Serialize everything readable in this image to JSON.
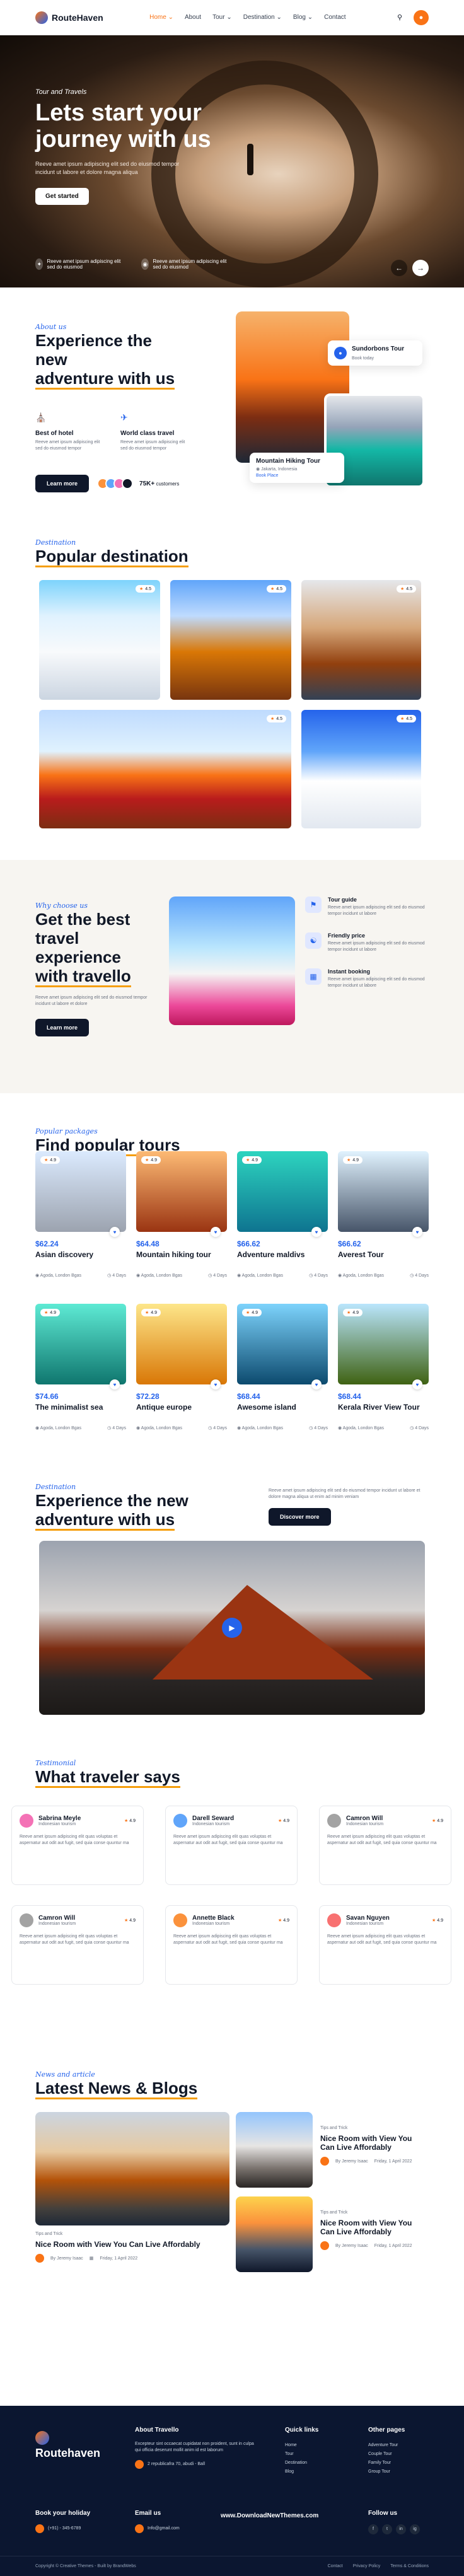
{
  "header": {
    "logo": "RouteHaven",
    "nav": [
      "Home",
      "About",
      "Tour",
      "Destination",
      "Blog",
      "Contact"
    ],
    "chevron": "⌄"
  },
  "hero": {
    "kicker": "Tour and Travels",
    "title": "Lets start your journey with us",
    "subtitle": "Reeve amet ipsum adipiscing elit sed do eiusmod tempor incidunt ut labore et dolore magna aliqua",
    "button": "Get started",
    "features": [
      "Reeve amet ipsum adipiscing elit sed do eiusmod",
      "Reeve amet ipsum adipiscing elit sed do eiusmod"
    ],
    "accent": "#f97316"
  },
  "about": {
    "kicker": "About us",
    "title_line1": "Experience the new",
    "title_line2": "adventure with us",
    "features": [
      {
        "title": "Best of hotel",
        "desc": "Reeve amet ipsum adipiscing elit sed do eiusmod tempor"
      },
      {
        "title": "World class travel",
        "desc": "Reeve amet ipsum adipiscing elit sed do eiusmod tempor"
      }
    ],
    "button": "Learn more",
    "customers_count": "75K+",
    "customers_label": "customers",
    "card1_title": "Sundorbons Tour",
    "card1_sub": "Book today",
    "card2_title": "Mountain Hiking Tour",
    "card2_loc": "Jakarta, Indonesia",
    "card2_link": "Book Place"
  },
  "destinations": {
    "kicker": "Destination",
    "title": "Popular destination",
    "ratings": [
      "4.5",
      "4.5",
      "4.5",
      "4.5",
      "4.5"
    ]
  },
  "why": {
    "kicker": "Why choose us",
    "title_line1": "Get the best",
    "title_line2": "travel experience",
    "title_line3": "with travello",
    "desc": "Reeve amet ipsum adipiscing elit sed do eiusmod tempor incidunt ut labore et dolore",
    "button": "Learn more",
    "items": [
      {
        "title": "Tour guide",
        "desc": "Reeve amet ipsum adipiscing elit sed do eiusmod tempor incidunt ut labore"
      },
      {
        "title": "Friendly price",
        "desc": "Reeve amet ipsum adipiscing elit sed do eiusmod tempor incidunt ut labore"
      },
      {
        "title": "Instant booking",
        "desc": "Reeve amet ipsum adipiscing elit sed do eiusmod tempor incidunt ut labore"
      }
    ]
  },
  "tours": {
    "kicker": "Popular packages",
    "title": "Find popular tours",
    "location": "Agoda, London Bgas",
    "days": "4 Days",
    "items": [
      {
        "price": "$62.24",
        "name": "Asian discovery",
        "rating": "4.9",
        "color1": "#dbeafe",
        "color2": "#9ca3af"
      },
      {
        "price": "$64.48",
        "name": "Mountain hiking tour",
        "rating": "4.9",
        "color1": "#fdba74",
        "color2": "#9a3412"
      },
      {
        "price": "$66.62",
        "name": "Adventure maldivs",
        "rating": "4.9",
        "color1": "#2dd4bf",
        "color2": "#0e7490"
      },
      {
        "price": "$66.62",
        "name": "Averest Tour",
        "rating": "4.9",
        "color1": "#e0f2fe",
        "color2": "#475569"
      },
      {
        "price": "$74.66",
        "name": "The minimalist sea",
        "rating": "4.9",
        "color1": "#5eead4",
        "color2": "#0f766e"
      },
      {
        "price": "$72.28",
        "name": "Antique europe",
        "rating": "4.9",
        "color1": "#fde68a",
        "color2": "#d97706"
      },
      {
        "price": "$68.44",
        "name": "Awesome island",
        "rating": "4.9",
        "color1": "#7dd3fc",
        "color2": "#0c4a6e"
      },
      {
        "price": "$68.44",
        "name": "Kerala River View Tour",
        "rating": "4.9",
        "color1": "#bae6fd",
        "color2": "#3f6212"
      }
    ]
  },
  "adventure": {
    "kicker": "Destination",
    "title_line1": "Experience the new",
    "title_line2": "adventure with us",
    "desc": "Reeve amet ipsum adipiscing elit sed do eiusmod tempor incidunt ut labore et dolore magna aliqua ut enim ad minim veniam",
    "button": "Discover more"
  },
  "testimonials": {
    "kicker": "Testimonial",
    "title": "What traveler says",
    "text": "Reeve amet ipsum adipiscing elit quas voluptas et aspernatur aut odit aut fugit, sed quia conse quuntur ma",
    "items": [
      {
        "name": "Sabrina Meyle",
        "role": "Indonesian tourism",
        "rating": "4.9",
        "color": "#f472b6"
      },
      {
        "name": "Darell Seward",
        "role": "Indonesian tourism",
        "rating": "4.9",
        "color": "#60a5fa"
      },
      {
        "name": "Camron Will",
        "role": "Indonesian tourism",
        "rating": "4.9",
        "color": "#a3a3a3"
      },
      {
        "name": "Camron Will",
        "role": "Indonesian tourism",
        "rating": "4.9",
        "color": "#a3a3a3"
      },
      {
        "name": "Annette Black",
        "role": "Indonesian tourism",
        "rating": "4.9",
        "color": "#fb923c"
      },
      {
        "name": "Savan Nguyen",
        "role": "Indonesian tourism",
        "rating": "4.9",
        "color": "#f87171"
      }
    ]
  },
  "news": {
    "kicker": "News and article",
    "title": "Latest News & Blogs",
    "category": "Tips and Trick",
    "main_title": "Nice Room with View You Can Live Affordably",
    "side_title": "Nice Room with View You Can Live Affordably",
    "author": "By Jeremy Isaac",
    "date": "Friday, 1 April 2022"
  },
  "footer": {
    "brand": "Routehaven",
    "about_title": "About Travello",
    "about_text": "Excepteur sint occaecat cupidatat non proident, sunt in culpa qui officia deserunt mollit anim id est laborum",
    "address": "2 republicafra 70, abudi - Ball",
    "quick_title": "Quick links",
    "quick": [
      "Home",
      "Tour",
      "Destination",
      "Blog"
    ],
    "other_title": "Other pages",
    "other": [
      "Adventure Tour",
      "Couple Tour",
      "Family Tour",
      "Group Tour"
    ],
    "book_title": "Book your holiday",
    "phone": "(+91) - 345-6789",
    "email_title": "Email us",
    "email": "Info@gmail.com",
    "website": "www.DownloadNewThemes.com",
    "follow": "Follow us",
    "social": [
      "f",
      "t",
      "in",
      "ig"
    ],
    "copyright": "Copyright © Creative Themes - Built by BrandWebs",
    "links": [
      "Contact",
      "Privacy Policy",
      "Terms & Conditions"
    ]
  }
}
